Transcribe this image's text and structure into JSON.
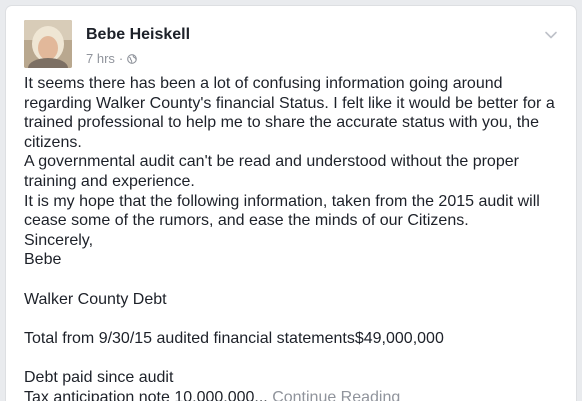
{
  "author": {
    "name": "Bebe Heiskell",
    "timestamp": "7 hrs",
    "separator": "·",
    "privacy_icon": "globe-icon"
  },
  "post": {
    "paragraphs": [
      "It seems there has been a lot of confusing information going around regarding Walker County's financial Status.  I felt like it would be better for a trained professional to help me to share the accurate status with you, the citizens.",
      "A governmental audit can't be read and understood without the proper training and experience.",
      "It is my hope that the following information, taken from the 2015 audit  will cease some of the rumors, and ease the minds of our Citizens.",
      "Sincerely,",
      "Bebe"
    ],
    "debt_heading": "Walker County  Debt",
    "total_line": "Total from 9/30/15 audited financial statements$49,000,000",
    "paid_heading": "Debt paid since audit",
    "tax_note_line": "Tax anticipation note  10,000,000...",
    "continue_label": "Continue Reading"
  },
  "colors": {
    "text": "#1d2129",
    "muted": "#90949c",
    "background": "#e9ebee"
  }
}
